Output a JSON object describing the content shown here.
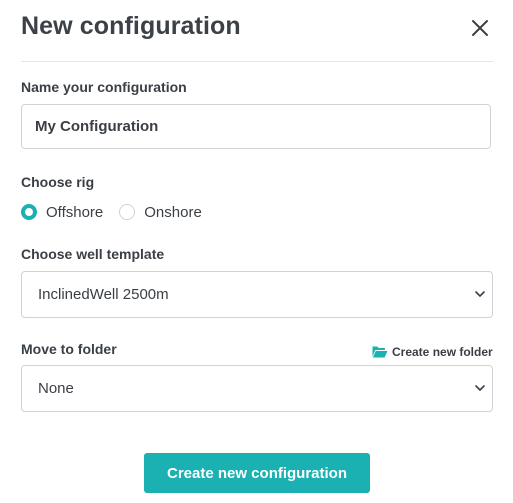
{
  "dialog": {
    "title": "New configuration",
    "close_icon": "close-icon"
  },
  "name_section": {
    "label": "Name your configuration",
    "value": "My Configuration"
  },
  "rig_section": {
    "label": "Choose rig",
    "options": [
      {
        "label": "Offshore",
        "checked": true
      },
      {
        "label": "Onshore",
        "checked": false
      }
    ]
  },
  "template_section": {
    "label": "Choose well template",
    "selected": "InclinedWell 2500m",
    "icon": "chevron-down-icon"
  },
  "folder_section": {
    "label": "Move to folder",
    "create_link": "Create new folder",
    "create_icon": "folder-open-icon",
    "selected": "None",
    "icon": "chevron-down-icon"
  },
  "actions": {
    "submit_label": "Create new configuration"
  },
  "colors": {
    "accent": "#1bb0b2",
    "text": "#3a3f45",
    "border": "#cfd3d8"
  }
}
